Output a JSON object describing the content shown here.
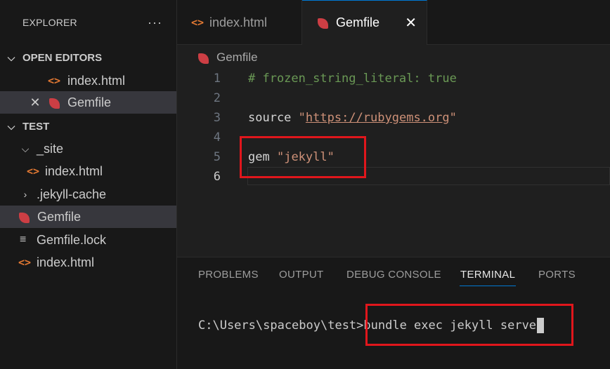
{
  "explorer": {
    "title": "EXPLORER",
    "more_label": "···",
    "open_editors": {
      "label": "OPEN EDITORS",
      "items": [
        {
          "name": "index.html"
        },
        {
          "name": "Gemfile"
        }
      ]
    },
    "workspace": {
      "label": "TEST",
      "items": [
        {
          "name": "_site"
        },
        {
          "name": "index.html"
        },
        {
          "name": ".jekyll-cache"
        },
        {
          "name": "Gemfile"
        },
        {
          "name": "Gemfile.lock"
        },
        {
          "name": "index.html"
        }
      ]
    }
  },
  "tabs": [
    {
      "label": "index.html",
      "icon": "html-icon"
    },
    {
      "label": "Gemfile",
      "icon": "ruby-icon"
    }
  ],
  "tab_close": "✕",
  "breadcrumb": {
    "file": "Gemfile"
  },
  "editor": {
    "lines": [
      {
        "number": "1",
        "text": "# frozen_string_literal: true"
      },
      {
        "number": "2",
        "text": ""
      },
      {
        "number": "3",
        "keyword": "source",
        "quote_open": "\"",
        "url": "https://rubygems.org",
        "quote_close": "\""
      },
      {
        "number": "4",
        "text": ""
      },
      {
        "number": "5",
        "keyword": "gem",
        "string": "\"jekyll\""
      },
      {
        "number": "6",
        "text": ""
      }
    ]
  },
  "panel": {
    "tabs": [
      "PROBLEMS",
      "OUTPUT",
      "DEBUG CONSOLE",
      "TERMINAL",
      "PORTS"
    ],
    "active_tab": "TERMINAL",
    "terminal": {
      "prompt": "C:\\Users\\spaceboy\\test>",
      "command": "bundle exec jekyll serve"
    }
  },
  "colors": {
    "accent": "#0078d4",
    "highlight": "#e0161c",
    "html_icon": "#e37933",
    "ruby_icon": "#cc3e44"
  }
}
